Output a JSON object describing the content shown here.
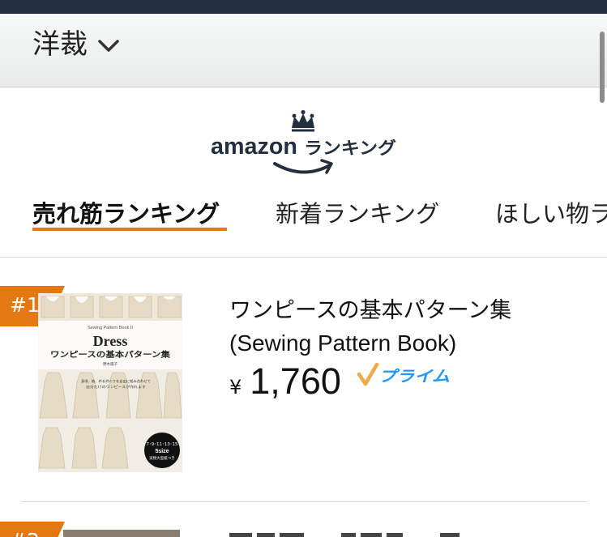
{
  "header": {
    "category_label": "洋裁",
    "chevron_icon": "chevron-down-icon"
  },
  "logo": {
    "brand_text": "amazon",
    "suffix_text": "ランキング",
    "crown_icon": "crown-icon",
    "smile_icon": "amazon-smile-arrow-icon"
  },
  "tabs": [
    {
      "label": "売れ筋ランキング",
      "active": true
    },
    {
      "label": "新着ランキング",
      "active": false
    },
    {
      "label": "ほしい物ラ",
      "active": false
    }
  ],
  "items": [
    {
      "rank": "#1",
      "title_line1": "ワンピースの基本パターン集",
      "title_line2": "(Sewing Pattern Book)",
      "currency": "¥",
      "price": "1,760",
      "prime_label": "プライム",
      "cover": {
        "series": "Sewing Pattern Book II",
        "title": "Dress",
        "subtitle": "ワンピースの基本パターン集",
        "author": "野木陽子",
        "tagline_line1": "身頃、袖、衿＆衿ぐりを自由に組み合わせて",
        "tagline_line2": "自分だけのワンピースが作れます",
        "sizes": "7･9･11･13･15",
        "size_label": "5size",
        "size_note": "実物大型紙つき"
      }
    },
    {
      "rank": "#2",
      "title_line1": "",
      "currency": "",
      "price": ""
    }
  ],
  "colors": {
    "accent_orange": "#e47911",
    "prime_blue": "#1a98ff",
    "prime_check": "#f3a847",
    "navy": "#232f3e"
  }
}
